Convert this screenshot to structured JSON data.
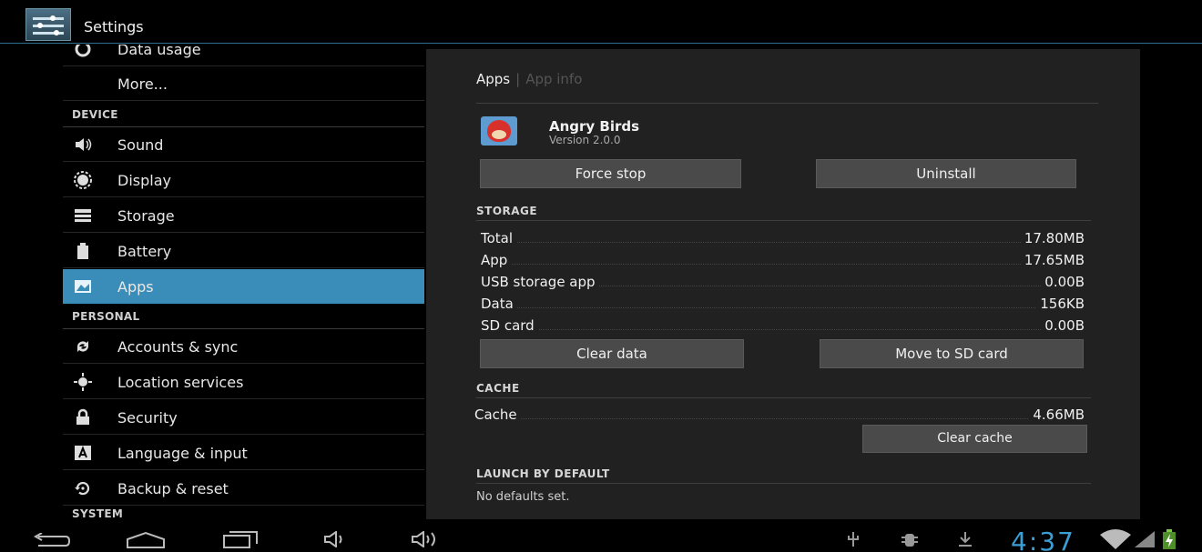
{
  "actionbar": {
    "title": "Settings",
    "icon": "settings-sliders-icon"
  },
  "sidebar": {
    "items": [
      {
        "label": "Data usage",
        "icon": "data-usage-icon"
      },
      {
        "label": "More...",
        "icon": ""
      },
      {
        "header": "DEVICE"
      },
      {
        "label": "Sound",
        "icon": "speaker-icon"
      },
      {
        "label": "Display",
        "icon": "display-brightness-icon"
      },
      {
        "label": "Storage",
        "icon": "storage-icon"
      },
      {
        "label": "Battery",
        "icon": "battery-icon"
      },
      {
        "label": "Apps",
        "icon": "apps-icon",
        "selected": true
      },
      {
        "header": "PERSONAL"
      },
      {
        "label": "Accounts & sync",
        "icon": "sync-icon"
      },
      {
        "label": "Location services",
        "icon": "location-icon"
      },
      {
        "label": "Security",
        "icon": "lock-icon"
      },
      {
        "label": "Language & input",
        "icon": "keyboard-icon"
      },
      {
        "label": "Backup & reset",
        "icon": "backup-icon"
      },
      {
        "header": "SYSTEM"
      }
    ]
  },
  "detail": {
    "breadcrumb": {
      "parent": "Apps",
      "current": "App info"
    },
    "app": {
      "name": "Angry Birds",
      "version": "Version 2.0.0",
      "icon": "angry-birds-app-icon"
    },
    "buttons": {
      "force_stop": "Force stop",
      "uninstall": "Uninstall",
      "clear_data": "Clear data",
      "move_to_sd": "Move to SD card",
      "clear_cache": "Clear cache"
    },
    "storage_header": "STORAGE",
    "storage": [
      {
        "key": "Total",
        "value": "17.80MB"
      },
      {
        "key": "App",
        "value": "17.65MB"
      },
      {
        "key": "USB storage app",
        "value": "0.00B"
      },
      {
        "key": "Data",
        "value": "156KB"
      },
      {
        "key": "SD card",
        "value": "0.00B"
      }
    ],
    "cache_header": "CACHE",
    "cache": {
      "key": "Cache",
      "value": "4.66MB"
    },
    "launch_header": "LAUNCH BY DEFAULT",
    "launch_text": "No defaults set."
  },
  "statusbar": {
    "time": "4:37"
  },
  "colors": {
    "accent": "#3a8db8",
    "clock": "#3a9fd4",
    "pane": "#212121",
    "button": "#4a4a4a"
  }
}
